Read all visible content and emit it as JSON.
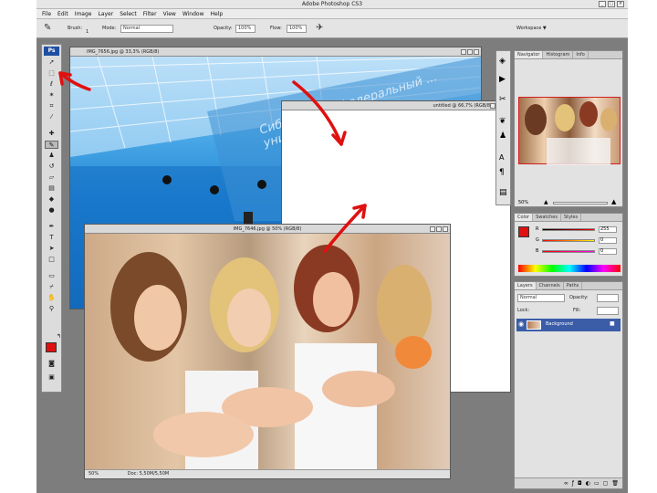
{
  "window": {
    "title": "Adobe Photoshop CS3"
  },
  "menu": [
    "File",
    "Edit",
    "Image",
    "Layer",
    "Select",
    "Filter",
    "View",
    "Window",
    "Help"
  ],
  "options": {
    "brush_label": "Brush:",
    "brush_size": "1",
    "mode_label": "Mode:",
    "mode_value": "Normal",
    "opacity_label": "Opacity:",
    "opacity_value": "100%",
    "flow_label": "Flow:",
    "flow_value": "100%",
    "workspace_label": "Workspace ▼"
  },
  "toolbox": {
    "logo": "Ps",
    "tools": [
      "move-tool",
      "marquee-tool",
      "lasso-tool",
      "magic-wand-tool",
      "crop-tool",
      "slice-tool",
      "healing-brush-tool",
      "brush-tool",
      "clone-stamp-tool",
      "history-brush-tool",
      "eraser-tool",
      "gradient-tool",
      "blur-tool",
      "dodge-tool",
      "pen-tool",
      "type-tool",
      "path-selection-tool",
      "shape-tool",
      "notes-tool",
      "eyedropper-tool",
      "hand-tool",
      "zoom-tool"
    ],
    "foreground_color": "#e01010",
    "background_color": "#ffffff"
  },
  "documents": {
    "doc1": {
      "title": "IMG_7656.jpg @ 33,3% (RGB/8)"
    },
    "doc2": {
      "title": "Untitled-1 @ 66,7% (RGB/8)",
      "title_visible": "untitled @ 66,7% (RGB/8)"
    },
    "doc3": {
      "title": "IMG_7646.jpg @ 50% (RGB/8)",
      "zoom": "50%",
      "status": "Doc: 5,50M/5,50M"
    }
  },
  "banner_text": "Сибирский... федеральный ... университет",
  "navigator": {
    "tabs": [
      "Navigator",
      "Histogram",
      "Info"
    ],
    "zoom": "50%"
  },
  "color_panel": {
    "tabs": [
      "Color",
      "Swatches",
      "Styles"
    ],
    "r_label": "R",
    "g_label": "G",
    "b_label": "B",
    "r": "255",
    "g": "0",
    "b": "0",
    "swatch": "#e01010"
  },
  "layers_panel": {
    "tabs": [
      "Layers",
      "Channels",
      "Paths"
    ],
    "mode": "Normal",
    "opacity_label": "Opacity:",
    "fill_label": "Fill:",
    "lock_label": "Lock:",
    "layer_name": "Background"
  },
  "colors": {
    "accent_arrow": "#e01010",
    "canvas_bg": "#7d7d7d"
  }
}
